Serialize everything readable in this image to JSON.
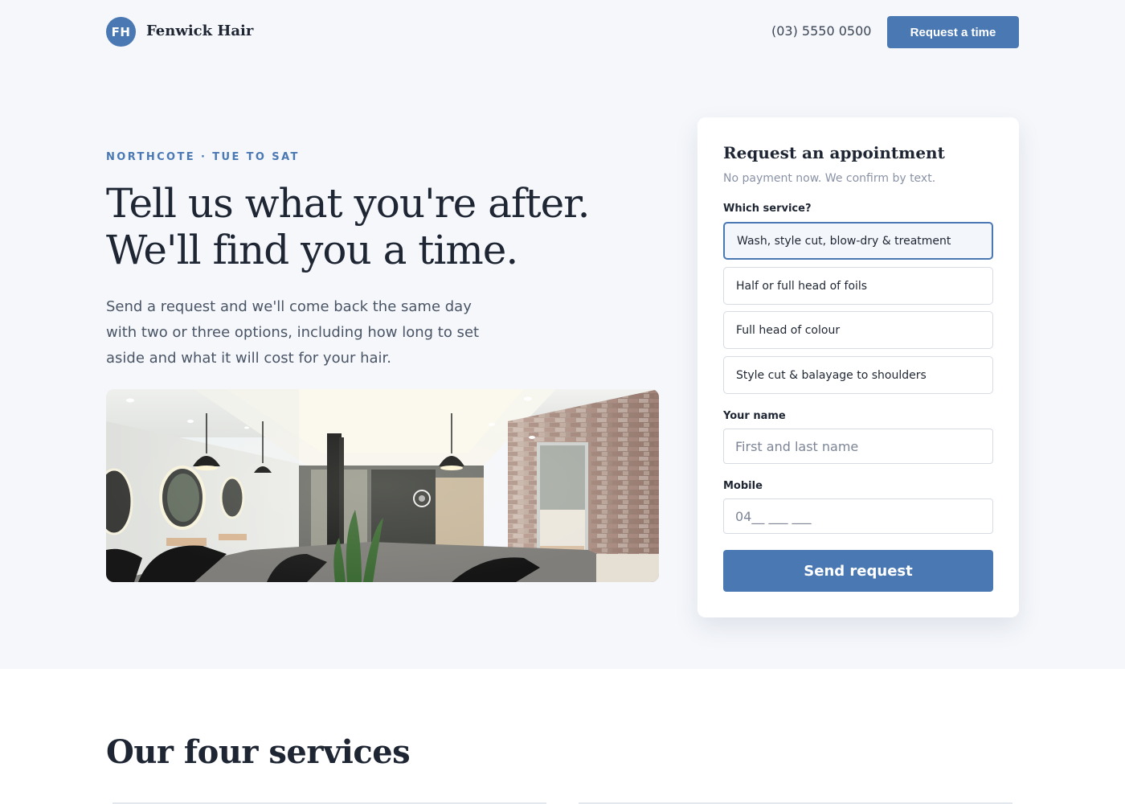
{
  "header": {
    "logo_initials": "FH",
    "brand": "Fenwick Hair",
    "phone": "(03) 5550 0500",
    "cta": "Request a time"
  },
  "hero": {
    "eyebrow": "NORTHCOTE · TUE TO SAT",
    "title": "Tell us what you're after. We'll find you a time.",
    "lead": "Send a request and we'll come back the same day with two or three options, including how long to set aside and what it will cost for your hair."
  },
  "form": {
    "title": "Request an appointment",
    "subtitle": "No payment now. We confirm by text.",
    "service_label": "Which service?",
    "services": [
      "Wash, style cut, blow-dry & treatment",
      "Half or full head of foils",
      "Full head of colour",
      "Style cut & balayage to shoulders"
    ],
    "selected_service": 0,
    "name_label": "Your name",
    "name_placeholder": "First and last name",
    "mobile_label": "Mobile",
    "mobile_placeholder": "04__ ___ ___",
    "submit": "Send request"
  },
  "services_section": {
    "title": "Our four services"
  },
  "colors": {
    "accent": "#4a78b3",
    "background": "#f5f7fb",
    "text": "#1f2633"
  }
}
